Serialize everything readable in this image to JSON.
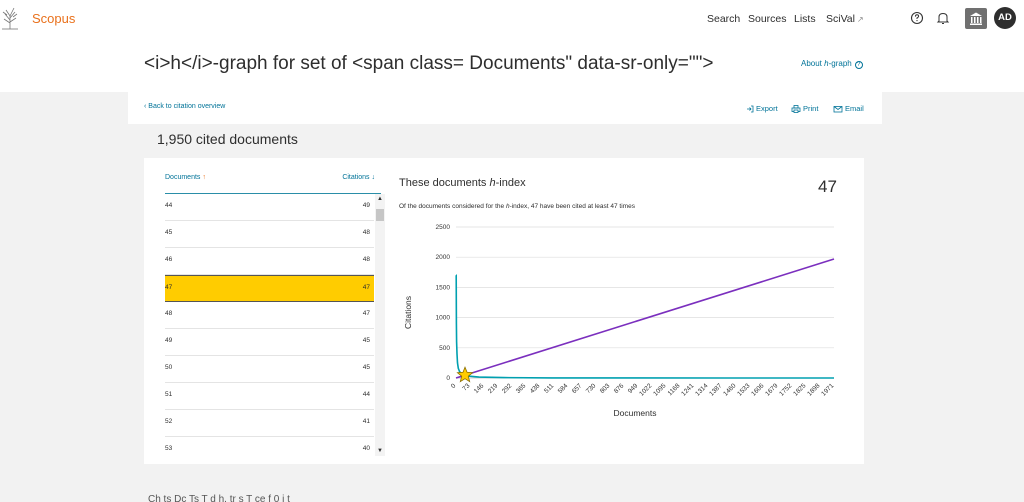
{
  "app": {
    "brand": "Scopus",
    "nav": [
      {
        "label": "Search"
      },
      {
        "label": "Sources"
      },
      {
        "label": "Lists"
      },
      {
        "label": "SciVal",
        "external": true
      }
    ],
    "ext_icon": "↗",
    "help_icon": "question-circle-icon",
    "bell_icon": "bell-icon",
    "institution_icon": "institution-icon",
    "avatar_initials": "AD",
    "brand_color": "#e9711c",
    "link_color": "#007398"
  },
  "page": {
    "title": "<i>h</i>-graph for set of <span class= Documents\" data-sr-only=\"\">",
    "about_link_pre": "About ",
    "about_link_h": "h",
    "about_link_post": "-graph",
    "about_icon": "?"
  },
  "toolbar": {
    "back_label": "Back to citation overview",
    "export_label": "Export",
    "print_label": "Print",
    "email_label": "Email"
  },
  "summary": {
    "cited_documents": "1,950 cited documents"
  },
  "table": {
    "col_documents": "Documents",
    "col_citations": "Citations",
    "sort_up": "↑",
    "sort_down": "↓",
    "rows": [
      {
        "doc": "44",
        "cit": "49",
        "highlight": false
      },
      {
        "doc": "45",
        "cit": "48",
        "highlight": false
      },
      {
        "doc": "46",
        "cit": "48",
        "highlight": false
      },
      {
        "doc": "47",
        "cit": "47",
        "highlight": true
      },
      {
        "doc": "48",
        "cit": "47",
        "highlight": false
      },
      {
        "doc": "49",
        "cit": "45",
        "highlight": false
      },
      {
        "doc": "50",
        "cit": "45",
        "highlight": false
      },
      {
        "doc": "51",
        "cit": "44",
        "highlight": false
      },
      {
        "doc": "52",
        "cit": "41",
        "highlight": false
      },
      {
        "doc": "53",
        "cit": "40",
        "highlight": false
      }
    ],
    "highlight_color": "#ffcc00"
  },
  "hindex": {
    "title_pre": "These documents ",
    "title_h": "h",
    "title_post": "-index",
    "value": "47",
    "sub_pre": "Of the documents considered for the ",
    "sub_h": "h",
    "sub_post": "-index, 47 have been cited at least 47 times"
  },
  "chart_data": {
    "type": "line",
    "xlabel": "Documents",
    "ylabel": "Citations",
    "x_ticks": [
      "0",
      "73",
      "146",
      "219",
      "292",
      "365",
      "438",
      "511",
      "584",
      "657",
      "730",
      "803",
      "876",
      "949",
      "1022",
      "1095",
      "1168",
      "1241",
      "1314",
      "1387",
      "1460",
      "1533",
      "1606",
      "1679",
      "1752",
      "1825",
      "1898",
      "1971"
    ],
    "y_ticks": [
      "0",
      "500",
      "1000",
      "1500",
      "2000",
      "2500"
    ],
    "xlim": [
      0,
      1971
    ],
    "ylim": [
      0,
      2500
    ],
    "grid": "horizontal",
    "series": [
      {
        "color": "#00a0b0",
        "points": [
          [
            0,
            1700
          ],
          [
            1,
            1700
          ],
          [
            2,
            900
          ],
          [
            3,
            600
          ],
          [
            5,
            400
          ],
          [
            8,
            250
          ],
          [
            12,
            160
          ],
          [
            18,
            110
          ],
          [
            25,
            80
          ],
          [
            35,
            60
          ],
          [
            47,
            47
          ],
          [
            70,
            30
          ],
          [
            120,
            15
          ],
          [
            250,
            6
          ],
          [
            500,
            2
          ],
          [
            900,
            1
          ],
          [
            1400,
            0
          ],
          [
            1971,
            0
          ]
        ]
      },
      {
        "color": "#7b2fbe",
        "points": [
          [
            0,
            0
          ],
          [
            1971,
            1971
          ]
        ]
      }
    ],
    "marker": {
      "shape": "star",
      "x": 47,
      "y": 47,
      "color": "#ffcc00"
    }
  },
  "footer": {
    "partial_text": "Ch ts    Dc Ts   T          d h. tr s       T      ce  f   0 i t  "
  }
}
